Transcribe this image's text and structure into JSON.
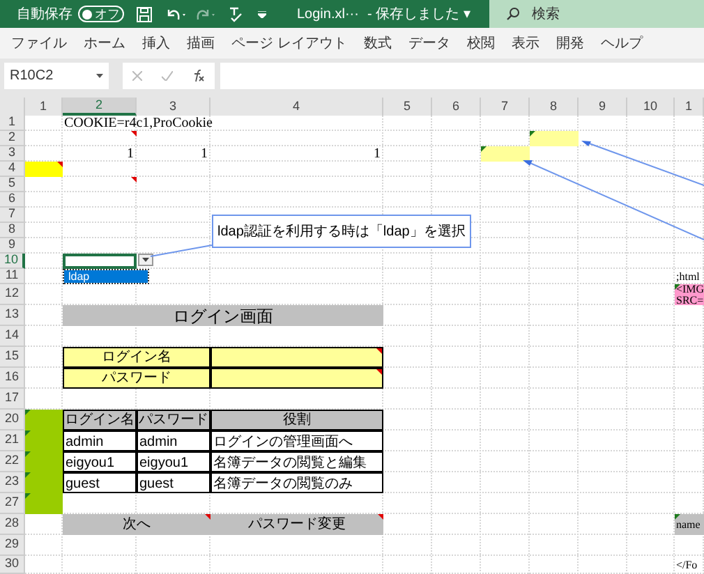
{
  "title_bar": {
    "autosave_label": "自動保存",
    "autosave_toggle": {
      "label": "オフ",
      "on": false
    },
    "file_name": "Login.xl···",
    "save_status": "- 保存しました ▾",
    "search_placeholder": "検索"
  },
  "ribbon_tabs": [
    "ファイル",
    "ホーム",
    "挿入",
    "描画",
    "ページ レイアウト",
    "数式",
    "データ",
    "校閲",
    "表示",
    "開発",
    "ヘルプ"
  ],
  "formula_bar": {
    "name_box": "R10C2"
  },
  "columns": [
    {
      "label": "1",
      "selected": false
    },
    {
      "label": "2",
      "selected": true
    },
    {
      "label": "3",
      "selected": false
    },
    {
      "label": "4",
      "selected": false
    },
    {
      "label": "5",
      "selected": false
    },
    {
      "label": "6",
      "selected": false
    },
    {
      "label": "7",
      "selected": false
    },
    {
      "label": "8",
      "selected": false
    },
    {
      "label": "9",
      "selected": false
    },
    {
      "label": "10",
      "selected": false
    },
    {
      "label": "1",
      "selected": false
    }
  ],
  "rows": [
    {
      "label": "1",
      "selected": false,
      "cells": [
        null,
        {
          "kind": "text",
          "text": "COOKIE=r4c1,ProCookie",
          "comment": false,
          "flag": false
        }
      ]
    },
    {
      "label": "2",
      "selected": false,
      "cells": [
        null,
        {
          "kind": "plain",
          "comment": true,
          "flag": false
        },
        null,
        null,
        null,
        null,
        null,
        {
          "kind": "note",
          "comment": false,
          "flag": true
        }
      ]
    },
    {
      "label": "3",
      "selected": false,
      "cells": [
        null,
        {
          "kind": "number",
          "text": "1",
          "comment": false,
          "flag": false
        },
        {
          "kind": "number",
          "text": "1",
          "comment": false,
          "flag": false
        },
        {
          "kind": "number",
          "text": "1",
          "comment": false,
          "flag": false
        },
        null,
        null,
        {
          "kind": "note",
          "comment": false,
          "flag": true
        }
      ]
    },
    {
      "label": "4",
      "selected": false,
      "cells": [
        {
          "kind": "highlight",
          "comment": true,
          "flag": false
        }
      ]
    },
    {
      "label": "5",
      "selected": false,
      "cells": [
        null,
        {
          "kind": "plain",
          "comment": true,
          "flag": false
        }
      ]
    },
    {
      "label": "6",
      "selected": false,
      "cells": []
    },
    {
      "label": "7",
      "selected": false,
      "cells": []
    },
    {
      "label": "8",
      "selected": false,
      "cells": []
    },
    {
      "label": "9",
      "selected": false,
      "cells": []
    },
    {
      "label": "10",
      "selected": true,
      "cells": [
        null,
        {
          "kind": "dropdown",
          "comment": false,
          "flag": false
        }
      ]
    },
    {
      "label": "11",
      "selected": false,
      "cells": [
        null,
        null,
        null,
        null,
        null,
        null,
        null,
        null,
        null,
        null,
        {
          "kind": "text",
          "text": ";html",
          "comment": false,
          "flag": false
        }
      ]
    },
    {
      "label": "12",
      "selected": false,
      "cells": [
        null,
        null,
        null,
        null,
        null,
        null,
        null,
        null,
        null,
        null,
        {
          "kind": "markup",
          "text": "<IMG",
          "text_2": "SRC=",
          "comment": false,
          "flag": true
        }
      ]
    },
    {
      "label": "13",
      "selected": false,
      "cells": [
        null,
        {
          "kind": "title",
          "text": "ログイン画面",
          "comment": false,
          "flag": false
        }
      ]
    },
    {
      "label": "14",
      "selected": false,
      "cells": []
    },
    {
      "label": "15",
      "selected": false,
      "cells": [
        null,
        {
          "kind": "label",
          "text": "ログイン名",
          "comment": false,
          "flag": false
        },
        {
          "kind": "input",
          "comment": true,
          "flag": false
        }
      ]
    },
    {
      "label": "16",
      "selected": false,
      "cells": [
        null,
        {
          "kind": "label",
          "text": "パスワード",
          "comment": false,
          "flag": false
        },
        {
          "kind": "input",
          "comment": true,
          "flag": false
        }
      ]
    },
    {
      "label": "17",
      "selected": false,
      "cells": []
    },
    {
      "label": "20",
      "selected": false,
      "cells": [
        {
          "kind": "green",
          "comment": false,
          "flag": true
        },
        {
          "kind": "header",
          "text": "ログイン名",
          "comment": false,
          "flag": false
        },
        {
          "kind": "header",
          "text": "パスワード",
          "comment": false,
          "flag": false
        },
        {
          "kind": "header",
          "text": "役割",
          "comment": false,
          "flag": false
        }
      ]
    },
    {
      "label": "21",
      "selected": false,
      "cells": [
        {
          "kind": "green",
          "comment": false,
          "flag": true
        },
        {
          "kind": "table",
          "text": "admin",
          "comment": false,
          "flag": false
        },
        {
          "kind": "table",
          "text": "admin",
          "comment": false,
          "flag": false
        },
        {
          "kind": "table",
          "text": "ログインの管理画面へ",
          "comment": false,
          "flag": false
        }
      ]
    },
    {
      "label": "22",
      "selected": false,
      "cells": [
        {
          "kind": "green",
          "comment": false,
          "flag": true
        },
        {
          "kind": "table",
          "text": "eigyou1",
          "comment": false,
          "flag": false
        },
        {
          "kind": "table",
          "text": "eigyou1",
          "comment": false,
          "flag": false
        },
        {
          "kind": "table",
          "text": "名簿データの閲覧と編集",
          "comment": false,
          "flag": false
        }
      ]
    },
    {
      "label": "23",
      "selected": false,
      "cells": [
        {
          "kind": "green",
          "comment": false,
          "flag": true
        },
        {
          "kind": "table",
          "text": "guest",
          "comment": false,
          "flag": false
        },
        {
          "kind": "table",
          "text": "guest",
          "comment": false,
          "flag": false
        },
        {
          "kind": "table",
          "text": "名簿データの閲覧のみ",
          "comment": false,
          "flag": false
        }
      ]
    },
    {
      "label": "27",
      "selected": false,
      "cells": [
        {
          "kind": "green",
          "comment": false,
          "flag": true
        }
      ]
    },
    {
      "label": "28",
      "selected": false,
      "cells": [
        null,
        {
          "kind": "button-wide",
          "text": "次へ",
          "comment": true,
          "flag": false
        },
        {
          "kind": "button",
          "text": "パスワード変更",
          "comment": true,
          "flag": false
        },
        null,
        null,
        null,
        null,
        null,
        null,
        {
          "kind": "grey",
          "text": "name",
          "comment": false,
          "flag": true
        }
      ]
    },
    {
      "label": "29",
      "selected": false,
      "cells": []
    },
    {
      "label": "30",
      "selected": false,
      "cells": [
        null,
        null,
        null,
        null,
        null,
        null,
        null,
        null,
        null,
        null,
        {
          "kind": "text",
          "text": "</Fo",
          "comment": false,
          "flag": false
        }
      ]
    }
  ],
  "dropdown_list": [
    {
      "text": "ldap",
      "selected": true
    }
  ],
  "callout": {
    "text": "ldap認証を利用する時は「ldap」を選択"
  }
}
